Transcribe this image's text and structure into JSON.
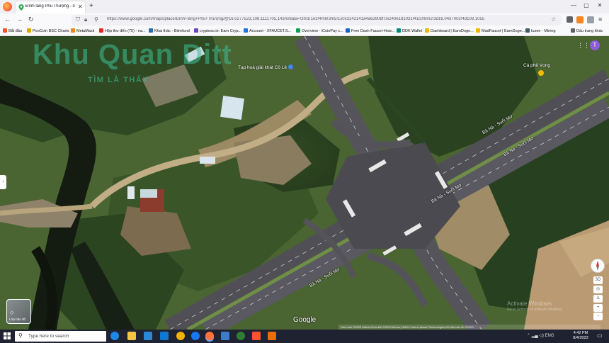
{
  "browser": {
    "tab_title": "Đình làng Phú Thượng - Google",
    "tab_close": "✕",
    "new_tab": "+",
    "url": "https://www.google.com/maps/place/Đình+làng+Phú+Thượng/@16.0277523,108.1111705,143m/data=!3m1!1e3!4m6!3m5!1s0x3142141a4a6390bf:0x240e181031f41c0!8m2!3d16.0437002!4d108.1055",
    "window_controls": [
      "—",
      "▢",
      "✕"
    ],
    "bookmarks": [
      {
        "label": "Bắt đầu",
        "color": "#e8572b"
      },
      {
        "label": "PooCoin BSC Charts",
        "color": "#e0a800"
      },
      {
        "label": "MetaMask",
        "color": "#f6851b"
      },
      {
        "label": "Hộp thư đến (75) - na...",
        "color": "#d93025"
      },
      {
        "label": "Khai thác - Bitrefund",
        "color": "#2b6cb0"
      },
      {
        "label": "cryptoso.io: Earn Cryp...",
        "color": "#6b46c1"
      },
      {
        "label": "Account - XFAUCET.S...",
        "color": "#1a73e8"
      },
      {
        "label": "Overview - iCoinPay c...",
        "color": "#0f9d58"
      },
      {
        "label": "Free Dash Faucet-How...",
        "color": "#1565c0"
      },
      {
        "label": "DDK Wallet",
        "color": "#00897b"
      },
      {
        "label": "Dashboard | EarnDoge...",
        "color": "#f4b400"
      },
      {
        "label": "MadFaucet | EarnDoge...",
        "color": "#f4b400"
      },
      {
        "label": "Iusee - Mining",
        "color": "#455a64"
      },
      {
        "label": "Dấu trang khác",
        "color": "#5f6368"
      }
    ]
  },
  "map": {
    "watermark_main": "Khu Quan Ditt",
    "watermark_sub": "TÌM LÀ THẤY",
    "poi_store": "Tạp hoá giải khát Cô Lê",
    "poi_cafe": "Cà phê Vọng",
    "road_labels": [
      "Bà Nà - Suối Mơ",
      "Bà Nà - Suối Mơ",
      "Bà Nà - Suối Mơ",
      "Bà Nà - Suối Mơ"
    ],
    "account_initial": "T",
    "layers_label": "Lớp bản đồ",
    "google_logo": "Google",
    "attribution": "Hình ảnh ©2023 Airbus,Hình ảnh ©2023 Airbus,CNES / Airbus,Maxar Technologies,Dữ liệu bản đồ ©2023",
    "activate_title": "Activate Windows",
    "activate_sub": "Go to Settings to activate Windows.",
    "controls": {
      "tilt": "3D",
      "zoom_in": "+",
      "zoom_out": "−"
    }
  },
  "taskbar": {
    "search_placeholder": "Type here to search",
    "apps": [
      {
        "name": "edge",
        "color": "#1e88e5"
      },
      {
        "name": "file-explorer",
        "color": "#f4c542"
      },
      {
        "name": "mail",
        "color": "#2b88d8"
      },
      {
        "name": "chrome",
        "color": "#f1b300"
      },
      {
        "name": "facebook",
        "color": "#1877f2"
      },
      {
        "name": "firefox",
        "color": "#ff7139"
      },
      {
        "name": "outlook",
        "color": "#0f78d4"
      },
      {
        "name": "app-green",
        "color": "#2e7d32"
      },
      {
        "name": "brave",
        "color": "#fb542b"
      },
      {
        "name": "app-orange",
        "color": "#ef6c00"
      }
    ],
    "tray_lang": "ENG",
    "clock_time": "4:42 PM",
    "clock_date": "8/4/2023"
  }
}
